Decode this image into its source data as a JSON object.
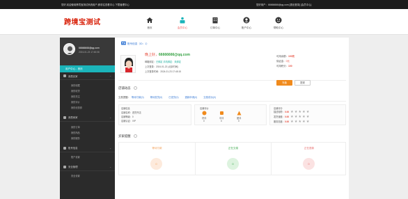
{
  "topbar": {
    "left": "您好,欢迎使用跨境宝测试系统用户,即前往查看中心 下载管理中心",
    "right": "您好用户：66666666@qq.com [退出登录] [会员中心]"
  },
  "header": {
    "logo": "跨境宝测试",
    "nav": [
      {
        "icon": "home-icon",
        "label": "首页"
      },
      {
        "icon": "shop-icon",
        "label": "会员中心",
        "active": true
      },
      {
        "icon": "building-icon",
        "label": "订单中心"
      },
      {
        "icon": "user-circle-icon",
        "label": "账户中心"
      },
      {
        "icon": "face-icon",
        "label": "帮助中心"
      }
    ]
  },
  "sidebar": {
    "user": "66666666@qq.com",
    "time": "2024-01-23 17:45:08",
    "home": "用户中心 - 首页",
    "sections": [
      {
        "icon": "lock-icon",
        "label": "我是买家",
        "items": [
          "我的收藏",
          "我的收货",
          "我的关注",
          "我的评价",
          "我的优惠券"
        ]
      },
      {
        "icon": "list-icon",
        "label": "我是卖家",
        "items": [
          "我的订单",
          "我的商品",
          "我的服务"
        ]
      },
      {
        "icon": "user-icon",
        "label": "账号信息",
        "items": [
          "账户设置"
        ]
      },
      {
        "icon": "gear-icon",
        "label": "安全管理",
        "items": [
          "安全设置"
        ]
      }
    ]
  },
  "profile": {
    "account_title": "账号信息（ID：1）",
    "greeting_1": "晚上好，",
    "greeting_email": "66666666@qq.com",
    "lines": [
      {
        "label": "邮箱绑定：",
        "value": "已绑定  手机绑定：未绑定"
      },
      {
        "label": "上次登录：",
        "value": "2024-01-22 (北京时间)"
      },
      {
        "label": "上次登录时间：",
        "value": "2024-01-23 17:45:15"
      }
    ],
    "right": [
      {
        "label": "可用余额：",
        "value": "100元"
      },
      {
        "label": "保证金：",
        "value": "0元"
      },
      {
        "label": "可用积分：",
        "value": "100"
      }
    ],
    "recharge_btn": "充值",
    "withdraw_btn": "提现"
  },
  "activity": {
    "title": "店铺动态",
    "tabs_label": "交易提醒：",
    "tabs": [
      "等待付款(0)",
      "等待发货(0)",
      "已发货(0)",
      "退款申请(0)",
      "交易成功(0)"
    ],
    "col1": {
      "title": "店铺信息",
      "rows": [
        "店铺名称：进货开店",
        "店铺等级：0",
        "店铺认证：VIP"
      ]
    },
    "col2": {
      "title": "店铺评价",
      "items": [
        {
          "label": "好评",
          "val": "0"
        },
        {
          "label": "中评",
          "val": "0"
        },
        {
          "label": "差评",
          "val": "0"
        }
      ]
    },
    "col3": {
      "title": "店铺评分",
      "rows": [
        {
          "label": "描述相符：",
          "score": "0.00"
        },
        {
          "label": "发货速度：",
          "score": "0.00"
        },
        {
          "label": "服务态度：",
          "score": "0.00"
        }
      ]
    }
  },
  "buyer": {
    "title": "买家提醒",
    "cols": [
      {
        "label": "等待付款",
        "val": "0",
        "color": "#f3a25c",
        "bg": "#fdeadc"
      },
      {
        "label": "正在交易",
        "val": "0",
        "color": "#3aa84a",
        "bg": "#ddf3df"
      },
      {
        "label": "正在退款",
        "val": "0",
        "color": "#e76b6b",
        "bg": "#fbe2e2"
      }
    ]
  },
  "colors": {
    "accent": "#1bb4ba",
    "brand": "#d81e06",
    "orange": "#f08a1c"
  }
}
